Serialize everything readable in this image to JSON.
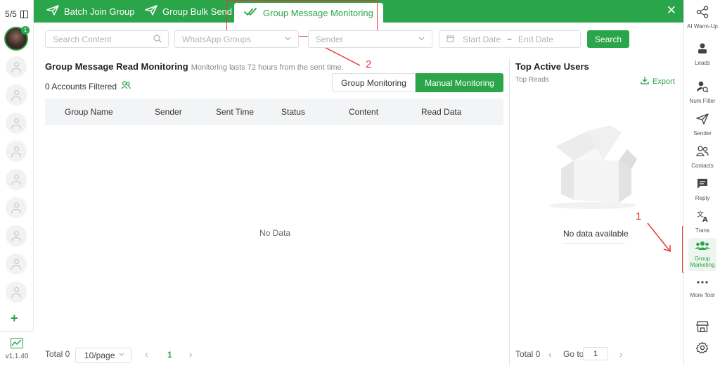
{
  "left_sidebar": {
    "account_count": "5/5",
    "avatar_badge": "1",
    "version": "v1.1.40"
  },
  "header": {
    "tabs": [
      {
        "label": "Batch Join Group",
        "icon": "send-icon"
      },
      {
        "label": "Group Bulk Send",
        "icon": "send-icon"
      },
      {
        "label": "Group Message Monitoring",
        "icon": "double-check-icon",
        "active": true
      }
    ],
    "close_icon": "close-icon"
  },
  "filters": {
    "search_placeholder": "Search Content",
    "groups_placeholder": "WhatsApp Groups",
    "sender_placeholder": "Sender",
    "start_date_placeholder": "Start Date",
    "date_separator": "~",
    "end_date_placeholder": "End Date",
    "search_button": "Search"
  },
  "main": {
    "title": "Group Message Read Monitoring",
    "subtitle": "Monitoring lasts 72 hours from the sent time.",
    "accounts_filtered": "0 Accounts Filtered",
    "segments": [
      "Group Monitoring",
      "Manual Monitoring"
    ],
    "active_segment": "Manual Monitoring",
    "columns": [
      "Group Name",
      "Sender",
      "Sent Time",
      "Status",
      "Content",
      "Read Data"
    ],
    "empty_text": "No Data",
    "pagination": {
      "total": "Total 0",
      "page_size": "10/page",
      "current_page": "1"
    }
  },
  "right_panel": {
    "title": "Top Active Users",
    "subtitle": "Top Reads",
    "export": "Export",
    "empty_text": "No data available",
    "pagination": {
      "total": "Total 0",
      "goto_label": "Go to",
      "goto_value": "1"
    }
  },
  "right_toolbar": {
    "items": [
      {
        "label": "AI Warm-Up",
        "icon": "share-nodes-icon"
      },
      {
        "label": "Leads",
        "icon": "leads-icon"
      },
      {
        "label": "Num Filter",
        "icon": "user-search-icon"
      },
      {
        "label": "Sender",
        "icon": "send-icon"
      },
      {
        "label": "Contacts",
        "icon": "contacts-icon"
      },
      {
        "label": "Reply",
        "icon": "chat-icon"
      },
      {
        "label": "Trans",
        "icon": "translate-icon"
      },
      {
        "label": "Group Marketing",
        "icon": "group-icon",
        "active": true
      },
      {
        "label": "More Tool",
        "icon": "more-dots-icon"
      }
    ],
    "bottom_icons": [
      "store-icon",
      "settings-icon"
    ]
  },
  "annotations": [
    "1",
    "2"
  ],
  "colors": {
    "brand_green": "#2aa54a",
    "annotation_red": "#e53935",
    "header_bg": "#f3f4f6"
  }
}
